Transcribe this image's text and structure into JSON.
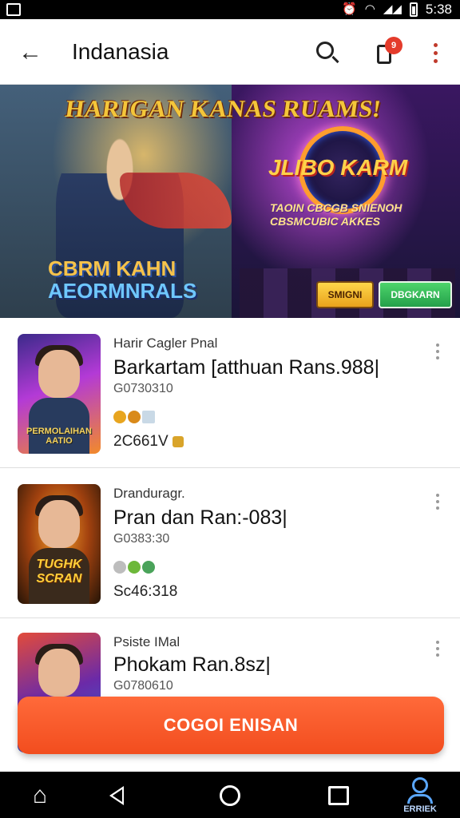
{
  "status_bar": {
    "time": "5:38"
  },
  "app_bar": {
    "title": "Indanasia",
    "notification_badge": "9"
  },
  "banner": {
    "title": "HARIGAN KANAS RUAMS!",
    "logo_text": "JLIBO KARM",
    "subtitle": "TAOIN CBCGB SNIENOH CBSMCUBIC AKKES",
    "left_text_line1": "CBRM KAHN",
    "left_text_line2": "AEORMNRALS",
    "button_1": "SMIGNI",
    "button_2": "DBGKARN"
  },
  "cards": [
    {
      "subtitle": "Harir Cagler Pnal",
      "title": "Barkartam [atthuan Rans.988|",
      "code": "G0730310",
      "meta": "2C661V",
      "thumb_label": "PERMOLAIHAN AATIO",
      "icon_colors": [
        "#e8a51f",
        "#d98a1a",
        "#c9d9e6"
      ]
    },
    {
      "subtitle": "Dranduragr.",
      "title": "Pran dan  Ran:-083|",
      "code": "G0383:30",
      "meta": "Sc46:318",
      "thumb_label": "TUGHK SCRAN",
      "icon_colors": [
        "#bdbdbd",
        "#6db83a",
        "#4aa35a"
      ]
    },
    {
      "subtitle": "Psiste IMal",
      "title": "Phokam Ran.8sz|",
      "code": "G0780610",
      "meta": "",
      "thumb_label": "",
      "icon_colors": []
    }
  ],
  "cta": {
    "label": "COGOI ENISAN"
  },
  "bottom_nav": {
    "profile_label": "ERRIEK"
  },
  "colors": {
    "accent": "#f24d1e",
    "badge": "#e43b2b"
  }
}
